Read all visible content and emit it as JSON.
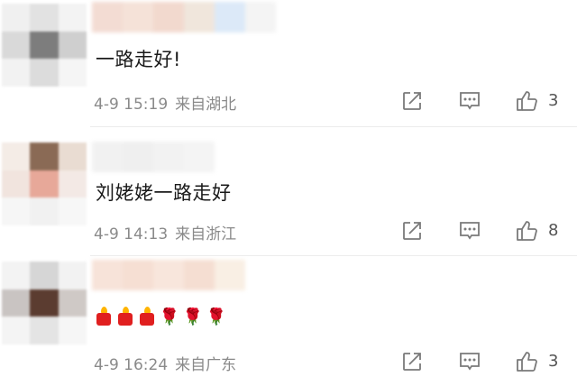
{
  "comments": [
    {
      "text": "一路走好!",
      "date": "4-9 15:19",
      "location": "来自湖北",
      "likes": "3"
    },
    {
      "text": "刘姥姥一路走好",
      "date": "4-9 14:13",
      "location": "来自浙江",
      "likes": "8"
    },
    {
      "emoji": [
        "candle-icon",
        "candle-icon",
        "candle-icon",
        "rose-icon",
        "rose-icon",
        "rose-icon"
      ],
      "date": "4-9 16:24",
      "location": "来自广东",
      "likes": "3"
    }
  ],
  "colors": {
    "text": "#1a1a1a",
    "meta": "#8a8a8a",
    "icon": "#7a7a7a"
  }
}
